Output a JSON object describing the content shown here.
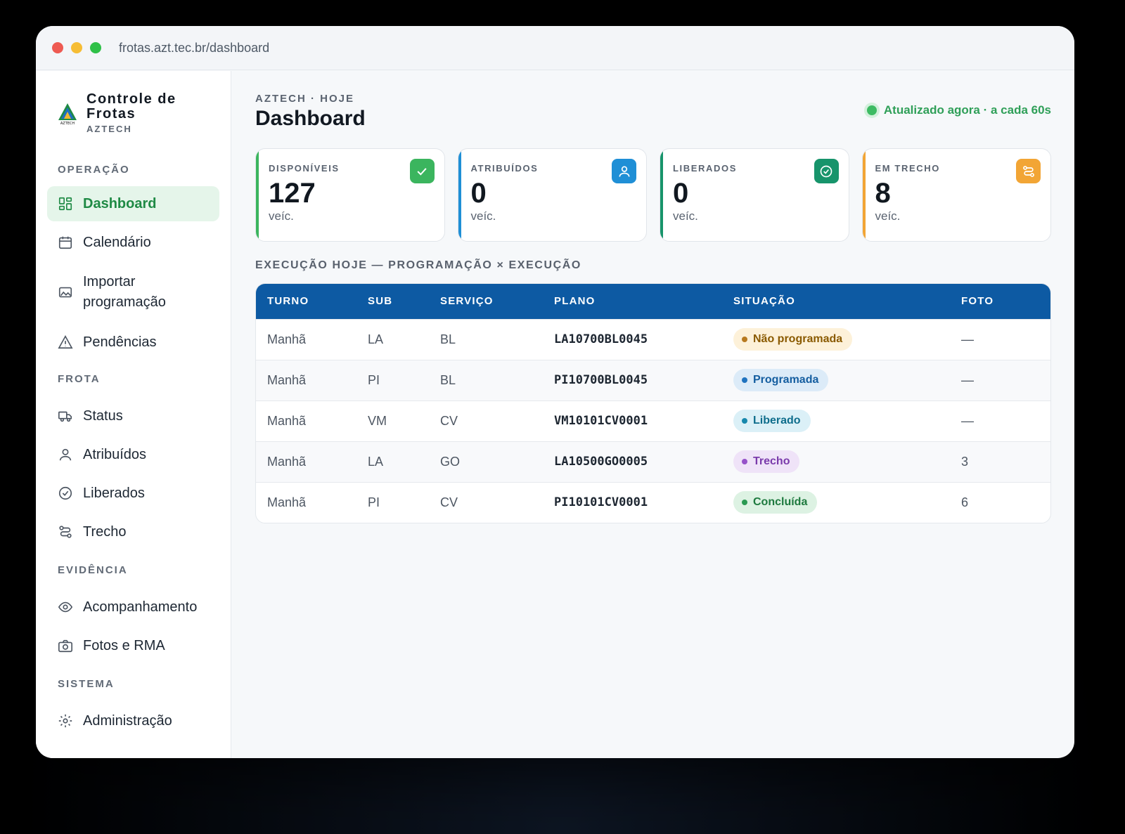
{
  "browser": {
    "url": "frotas.azt.tec.br/dashboard"
  },
  "brand": {
    "title": "Controle de Frotas",
    "subtitle": "AZTECH",
    "logo_text": "AZTECH"
  },
  "sidebar": {
    "sections": [
      {
        "label": "OPERAÇÃO"
      },
      {
        "label": "FROTA"
      },
      {
        "label": "EVIDÊNCIA"
      },
      {
        "label": "SISTEMA"
      }
    ],
    "items": [
      {
        "label": "Dashboard",
        "icon": "grid-icon",
        "active": true
      },
      {
        "label": "Calendário",
        "icon": "calendar-icon"
      },
      {
        "label": "Importar programação",
        "icon": "image-icon"
      },
      {
        "label": "Pendências",
        "icon": "warning-icon"
      },
      {
        "label": "Status",
        "icon": "truck-icon"
      },
      {
        "label": "Atribuídos",
        "icon": "user-icon"
      },
      {
        "label": "Liberados",
        "icon": "check-circle-icon"
      },
      {
        "label": "Trecho",
        "icon": "route-icon"
      },
      {
        "label": "Acompanhamento",
        "icon": "eye-icon"
      },
      {
        "label": "Fotos e RMA",
        "icon": "camera-icon"
      },
      {
        "label": "Administração",
        "icon": "gear-icon"
      }
    ]
  },
  "header": {
    "breadcrumb": "AZTECH · HOJE",
    "title": "Dashboard",
    "status": "Atualizado agora · a cada 60s"
  },
  "cards": [
    {
      "label": "DISPONÍVEIS",
      "value": "127",
      "unit": "veíc.",
      "color": "#3bb55e",
      "icon": "check-icon"
    },
    {
      "label": "ATRIBUÍDOS",
      "value": "0",
      "unit": "veíc.",
      "color": "#1f8fd6",
      "icon": "user-icon"
    },
    {
      "label": "LIBERADOS",
      "value": "0",
      "unit": "veíc.",
      "color": "#17946b",
      "icon": "check-circle-icon"
    },
    {
      "label": "EM TRECHO",
      "value": "8",
      "unit": "veíc.",
      "color": "#f2a535",
      "icon": "route-icon"
    }
  ],
  "section_title": "EXECUÇÃO HOJE — PROGRAMAÇÃO × EXECUÇÃO",
  "table": {
    "columns": [
      "TURNO",
      "SUB",
      "SERVIÇO",
      "PLANO",
      "SITUAÇÃO",
      "FOTO"
    ],
    "rows": [
      {
        "turno": "Manhã",
        "sub": "LA",
        "servico": "BL",
        "plano": "LA10700BL0045",
        "situacao": "Não programada",
        "status_bg": "#fdf1d9",
        "status_fg": "#8a5a00",
        "status_dot": "#b7791f",
        "foto": "—"
      },
      {
        "turno": "Manhã",
        "sub": "PI",
        "servico": "BL",
        "plano": "PI10700BL0045",
        "situacao": "Programada",
        "status_bg": "#dcebf8",
        "status_fg": "#155ea0",
        "status_dot": "#1f73bf",
        "foto": "—"
      },
      {
        "turno": "Manhã",
        "sub": "VM",
        "servico": "CV",
        "plano": "VM10101CV0001",
        "situacao": "Liberado",
        "status_bg": "#dbf0f7",
        "status_fg": "#0e6d8c",
        "status_dot": "#1788ad",
        "foto": "—"
      },
      {
        "turno": "Manhã",
        "sub": "LA",
        "servico": "GO",
        "plano": "LA10500GO0005",
        "situacao": "Trecho",
        "status_bg": "#efe3f8",
        "status_fg": "#7a3aab",
        "status_dot": "#9652c9",
        "foto": "3"
      },
      {
        "turno": "Manhã",
        "sub": "PI",
        "servico": "CV",
        "plano": "PI10101CV0001",
        "situacao": "Concluída",
        "status_bg": "#ddf2e3",
        "status_fg": "#1e7a3f",
        "status_dot": "#2a9a52",
        "foto": "6"
      }
    ]
  }
}
